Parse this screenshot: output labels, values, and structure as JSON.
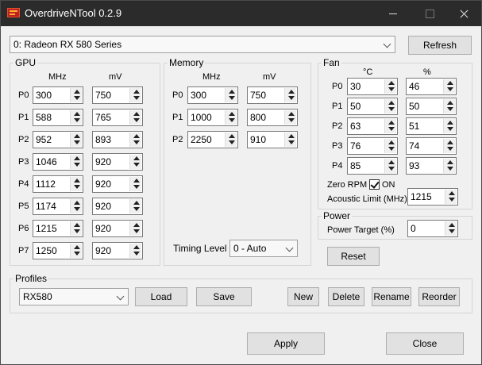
{
  "window": {
    "title": "OverdriveNTool 0.2.9"
  },
  "gpu_select": {
    "value": "0: Radeon RX 580 Series"
  },
  "refresh_label": "Refresh",
  "gpu": {
    "title": "GPU",
    "col1": "MHz",
    "col2": "mV",
    "rows": [
      {
        "p": "P0",
        "mhz": "300",
        "mv": "750"
      },
      {
        "p": "P1",
        "mhz": "588",
        "mv": "765"
      },
      {
        "p": "P2",
        "mhz": "952",
        "mv": "893"
      },
      {
        "p": "P3",
        "mhz": "1046",
        "mv": "920"
      },
      {
        "p": "P4",
        "mhz": "1112",
        "mv": "920"
      },
      {
        "p": "P5",
        "mhz": "1174",
        "mv": "920"
      },
      {
        "p": "P6",
        "mhz": "1215",
        "mv": "920"
      },
      {
        "p": "P7",
        "mhz": "1250",
        "mv": "920"
      }
    ]
  },
  "memory": {
    "title": "Memory",
    "col1": "MHz",
    "col2": "mV",
    "rows": [
      {
        "p": "P0",
        "mhz": "300",
        "mv": "750"
      },
      {
        "p": "P1",
        "mhz": "1000",
        "mv": "800"
      },
      {
        "p": "P2",
        "mhz": "2250",
        "mv": "910"
      }
    ],
    "timing_label": "Timing Level",
    "timing_value": "0 - Auto"
  },
  "fan": {
    "title": "Fan",
    "col1": "°C",
    "col2": "%",
    "rows": [
      {
        "p": "P0",
        "temp": "30",
        "pct": "46"
      },
      {
        "p": "P1",
        "temp": "50",
        "pct": "50"
      },
      {
        "p": "P2",
        "temp": "63",
        "pct": "51"
      },
      {
        "p": "P3",
        "temp": "76",
        "pct": "74"
      },
      {
        "p": "P4",
        "temp": "85",
        "pct": "93"
      }
    ],
    "zero_rpm_label": "Zero RPM",
    "zero_rpm_state": "ON",
    "acoustic_label": "Acoustic Limit (MHz)",
    "acoustic_value": "1215"
  },
  "power": {
    "title": "Power",
    "target_label": "Power Target (%)",
    "target_value": "0"
  },
  "reset_label": "Reset",
  "profiles": {
    "title": "Profiles",
    "selected": "RX580",
    "load": "Load",
    "save": "Save",
    "new": "New",
    "delete": "Delete",
    "rename": "Rename",
    "reorder": "Reorder"
  },
  "apply_label": "Apply",
  "close_label": "Close"
}
